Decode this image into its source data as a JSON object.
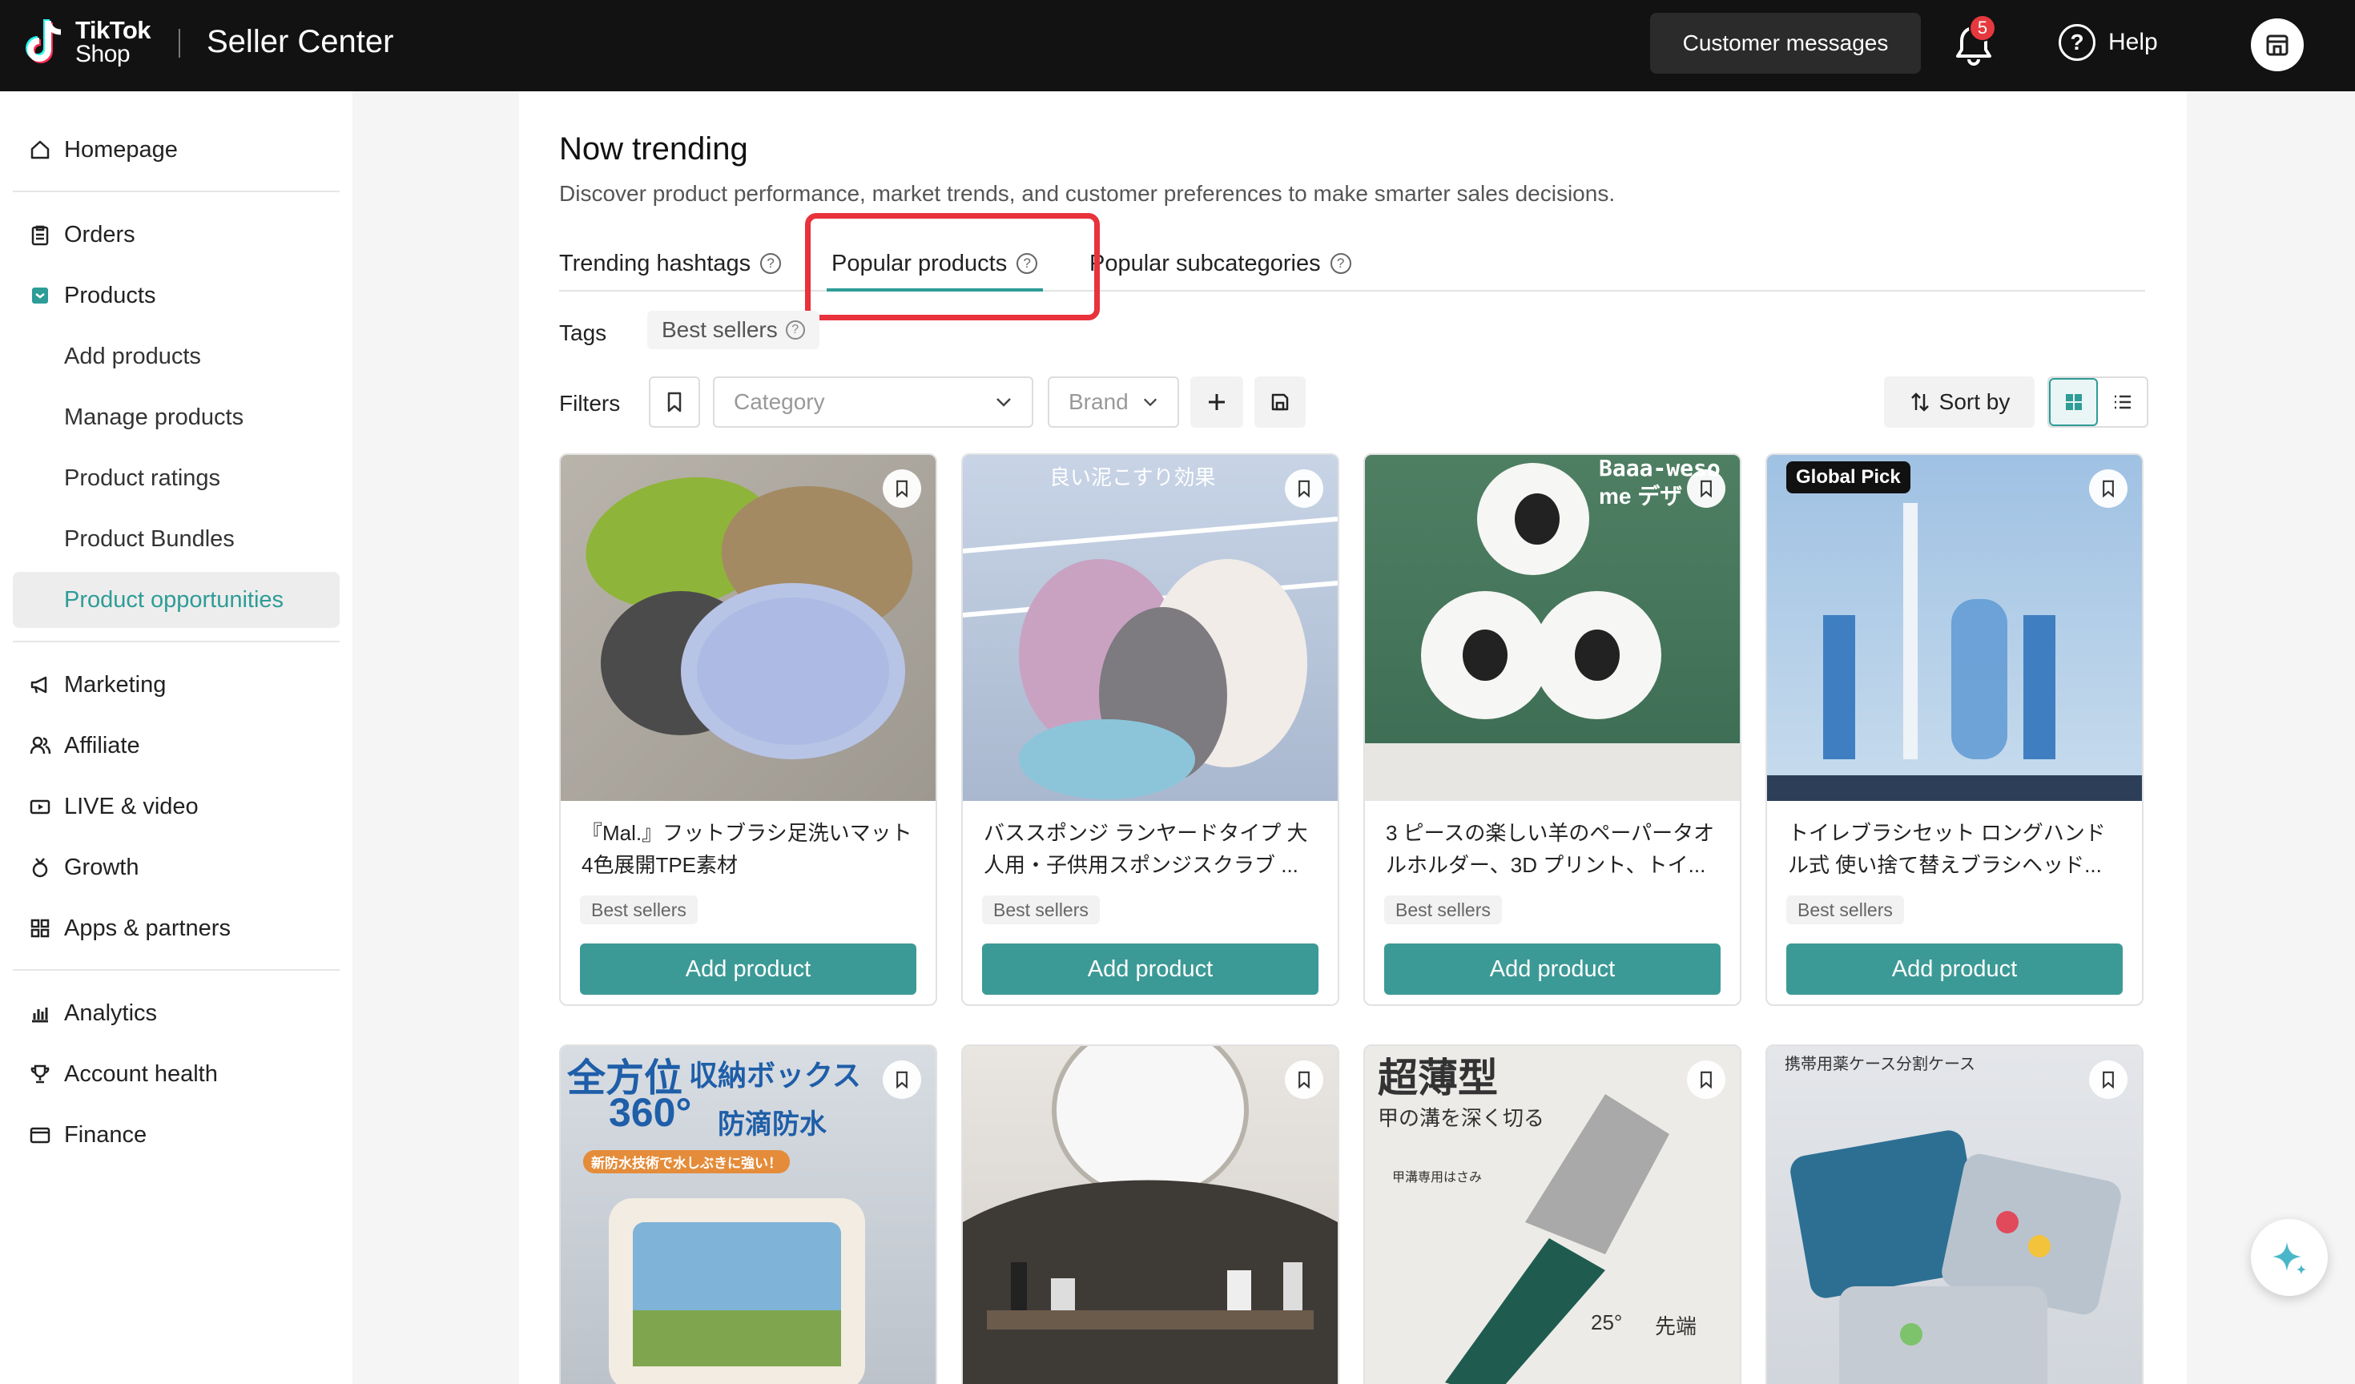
{
  "header": {
    "brand_line1": "TikTok",
    "brand_line2": "Shop",
    "title": "Seller Center",
    "customer_messages": "Customer messages",
    "notification_count": "5",
    "help": "Help"
  },
  "sidebar": {
    "items": [
      {
        "label": "Homepage",
        "icon": "home-icon"
      },
      {
        "label": "Orders",
        "icon": "clipboard-icon"
      },
      {
        "label": "Products",
        "icon": "product-box-icon"
      },
      {
        "label": "Add products"
      },
      {
        "label": "Manage products"
      },
      {
        "label": "Product ratings"
      },
      {
        "label": "Product Bundles"
      },
      {
        "label": "Product opportunities",
        "active": true
      },
      {
        "label": "Marketing",
        "icon": "megaphone-icon"
      },
      {
        "label": "Affiliate",
        "icon": "people-icon"
      },
      {
        "label": "LIVE & video",
        "icon": "video-icon"
      },
      {
        "label": "Growth",
        "icon": "medal-icon"
      },
      {
        "label": "Apps & partners",
        "icon": "apps-grid-icon"
      },
      {
        "label": "Analytics",
        "icon": "bar-chart-icon"
      },
      {
        "label": "Account health",
        "icon": "trophy-icon"
      },
      {
        "label": "Finance",
        "icon": "wallet-icon"
      }
    ]
  },
  "main": {
    "title": "Now trending",
    "description": "Discover product performance, market trends, and customer preferences to make smarter sales decisions.",
    "tabs": [
      {
        "label": "Trending hashtags"
      },
      {
        "label": "Popular products",
        "active": true
      },
      {
        "label": "Popular subcategories"
      }
    ],
    "tags_label": "Tags",
    "tag": "Best sellers",
    "filters_label": "Filters",
    "category_placeholder": "Category",
    "brand_placeholder": "Brand",
    "sort_by": "Sort by",
    "accent_color": "#3c9a96",
    "highlight_color": "#e8323c"
  },
  "products": [
    {
      "title": "『Mal.』フットブラシ足洗いマット 4色展開TPE素材",
      "tag": "Best sellers",
      "button": "Add product"
    },
    {
      "title": "バススポンジ ランヤードタイプ 大人用・子供用スポンジスクラブ ...",
      "tag": "Best sellers",
      "button": "Add product",
      "image_text": [
        "良い泥こすり効果"
      ]
    },
    {
      "title": "3 ピースの楽しい羊のペーパータオルホルダー、3D プリント、トイ...",
      "tag": "Best sellers",
      "button": "Add product",
      "image_text": [
        "Baaa-weso",
        "me デザ"
      ]
    },
    {
      "title": "トイレブラシセット ロングハンドル式 使い捨て替えブラシヘッド...",
      "tag": "Best sellers",
      "button": "Add product",
      "image_text": [
        "Global Pick"
      ]
    },
    {
      "image_text": [
        "全方位",
        "収納ボックス",
        "360°",
        "防滴防水",
        "新防水技術で水しぶきに強い！"
      ]
    },
    {},
    {
      "image_text": [
        "超薄型",
        "甲の溝を深く切る",
        "甲溝専用はさみ",
        "25°",
        "先端"
      ]
    },
    {
      "image_text": [
        "携帯用薬ケース分割ケース"
      ]
    }
  ]
}
